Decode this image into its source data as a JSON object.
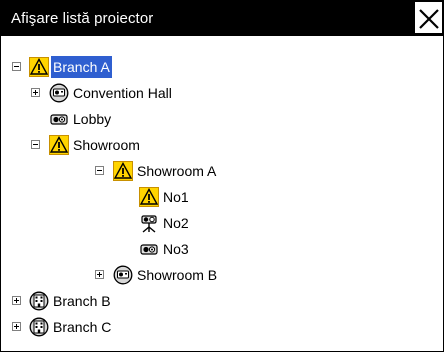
{
  "window": {
    "title": "Afişare listă proiector"
  },
  "tree": [
    {
      "name": "tree-item-branch-a",
      "label": "Branch A",
      "icon": "warning-icon",
      "expander": "minus",
      "selected": true
    },
    {
      "name": "tree-item-convention-hall",
      "label": "Convention Hall",
      "icon": "projector-icon",
      "expander": "plus",
      "selected": false
    },
    {
      "name": "tree-item-lobby",
      "label": "Lobby",
      "icon": "projector-small-icon",
      "expander": "none",
      "selected": false
    },
    {
      "name": "tree-item-showroom",
      "label": "Showroom",
      "icon": "warning-icon",
      "expander": "minus",
      "selected": false
    },
    {
      "name": "tree-item-showroom-a",
      "label": "Showroom A",
      "icon": "warning-icon",
      "expander": "minus",
      "selected": false
    },
    {
      "name": "tree-item-no1",
      "label": "No1",
      "icon": "warning-icon",
      "expander": "none",
      "selected": false
    },
    {
      "name": "tree-item-no2",
      "label": "No2",
      "icon": "projector-stand-icon",
      "expander": "none",
      "selected": false
    },
    {
      "name": "tree-item-no3",
      "label": "No3",
      "icon": "projector-small-icon",
      "expander": "none",
      "selected": false
    },
    {
      "name": "tree-item-showroom-b",
      "label": "Showroom B",
      "icon": "projector-icon",
      "expander": "plus",
      "selected": false
    },
    {
      "name": "tree-item-branch-b",
      "label": "Branch B",
      "icon": "building-icon",
      "expander": "plus",
      "selected": false
    },
    {
      "name": "tree-item-branch-c",
      "label": "Branch C",
      "icon": "building-icon",
      "expander": "plus",
      "selected": false
    }
  ],
  "colors": {
    "selection": "#2f5fd0",
    "warning": "#ffd400",
    "warning_border": "#c89000"
  }
}
